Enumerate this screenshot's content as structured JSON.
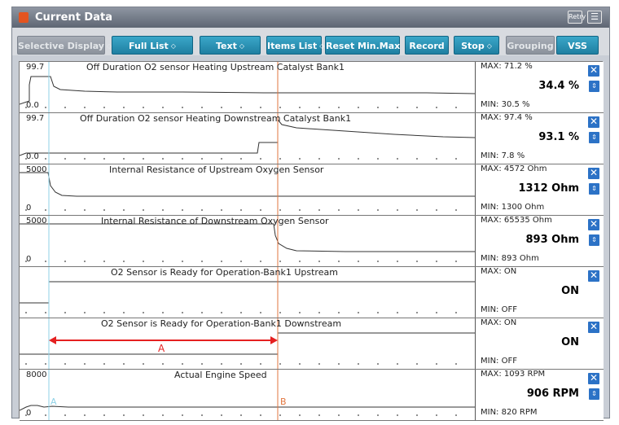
{
  "window": {
    "title": "Current Data",
    "retry_icon": "retry-icon",
    "menu_icon": "menu-icon",
    "retry_label": "Retry"
  },
  "toolbar": {
    "buttons": [
      {
        "label": "Selective Display",
        "dropdown": true,
        "disabled": true
      },
      {
        "label": "Full List",
        "dropdown": true,
        "disabled": false
      },
      {
        "label": "Text",
        "dropdown": true,
        "disabled": false
      },
      {
        "label": "Items List",
        "dropdown": true,
        "disabled": false
      },
      {
        "label": "Reset Min.Max",
        "dropdown": false,
        "disabled": false
      },
      {
        "label": "Record",
        "dropdown": false,
        "disabled": false
      },
      {
        "label": "Stop",
        "dropdown": true,
        "disabled": false
      },
      {
        "label": "Grouping",
        "dropdown": false,
        "disabled": true
      },
      {
        "label": "VSS",
        "dropdown": false,
        "disabled": false
      }
    ]
  },
  "panels": [
    {
      "title": "Off Duration O2 sensor Heating Upstream Catalyst Bank1",
      "ymax": "99.7",
      "ymin": "0.0",
      "max": "MAX:  71.2 %",
      "current": "34.4 %",
      "min": "MIN:  30.5 %",
      "kind": "upstream_heat"
    },
    {
      "title": "Off Duration O2 sensor Heating Downstream Catalyst Bank1",
      "ymax": "99.7",
      "ymin": "0.0",
      "max": "MAX:  97.4 %",
      "current": "93.1 %",
      "min": "MIN:  7.8 %",
      "kind": "downstream_heat"
    },
    {
      "title": "Internal Resistance of Upstream Oxygen Sensor",
      "ymax": "5000",
      "ymin": "0",
      "max": "MAX:  4572 Ohm",
      "current": "1312 Ohm",
      "min": "MIN:  1300 Ohm",
      "kind": "upstream_res"
    },
    {
      "title": "Internal Resistance of Downstream Oxygen Sensor",
      "ymax": "5000",
      "ymin": "0",
      "max": "MAX: 65535 Ohm",
      "current": "893 Ohm",
      "min": "MIN:  893 Ohm",
      "kind": "downstream_res"
    },
    {
      "title": "O2 Sensor is Ready for Operation-Bank1 Upstream",
      "ymax": "",
      "ymin": "",
      "max": "MAX: ON",
      "current": "ON",
      "min": "MIN: OFF",
      "kind": "upstream_ready"
    },
    {
      "title": "O2 Sensor is Ready for Operation-Bank1 Downstream",
      "ymax": "",
      "ymin": "",
      "max": "MAX: ON",
      "current": "ON",
      "min": "MIN: OFF",
      "kind": "downstream_ready"
    },
    {
      "title": "Actual Engine Speed",
      "ymax": "8000",
      "ymin": "0",
      "max": "MAX:  1093 RPM",
      "current": "906 RPM",
      "min": "MIN:  820 RPM",
      "kind": "engine_speed"
    }
  ],
  "cursors": {
    "a_label": "A",
    "b_label": "B",
    "color_a": "#8fd2e7",
    "color_b": "#e2763f"
  },
  "annotation": {
    "label": "A",
    "color": "#e52020"
  }
}
